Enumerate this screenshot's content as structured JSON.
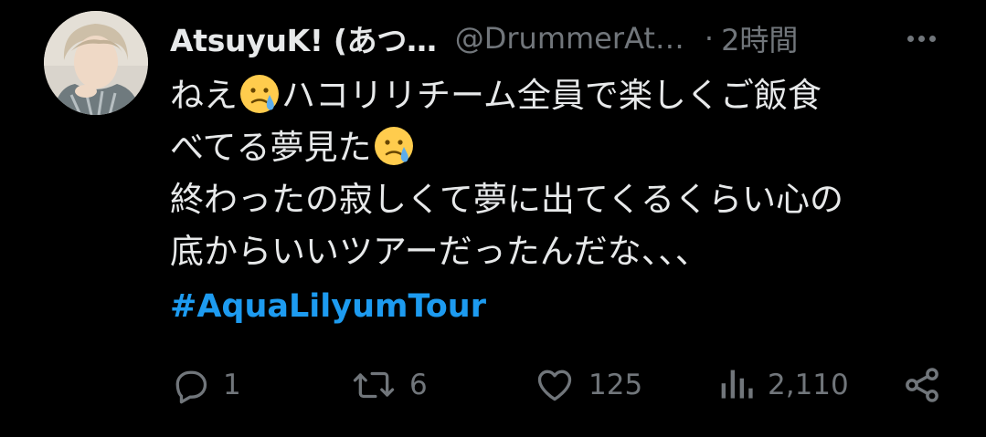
{
  "tweet": {
    "author_name": "AtsuyuK! (あつ…",
    "author_handle": "@DrummerAt…",
    "separator": "·",
    "timestamp": "2時間",
    "lines": [
      {
        "parts": [
          "ねえ",
          "ハコリリチーム全員で楽しくご飯食"
        ],
        "emoji_after_first": "crying-face-emoji"
      },
      {
        "parts": [
          "べてる夢見た"
        ],
        "emoji_after_first": "crying-face-emoji"
      },
      {
        "parts": [
          "終わったの寂しくて夢に出てくるくらい心の"
        ]
      },
      {
        "parts": [
          "底からいいツアーだったんだな、、、"
        ]
      }
    ],
    "hashtag": "#AquaLilyumTour"
  },
  "actions": {
    "reply_count": "1",
    "retweet_count": "6",
    "like_count": "125",
    "view_count": "2,110"
  },
  "icons": {
    "more": "more-dots-icon",
    "reply": "reply-icon",
    "retweet": "retweet-icon",
    "like": "heart-icon",
    "views": "views-chart-icon",
    "share": "share-icon"
  },
  "colors": {
    "background": "#000000",
    "text": "#e7e9ea",
    "muted": "#71767b",
    "accent": "#1d9bf0"
  }
}
